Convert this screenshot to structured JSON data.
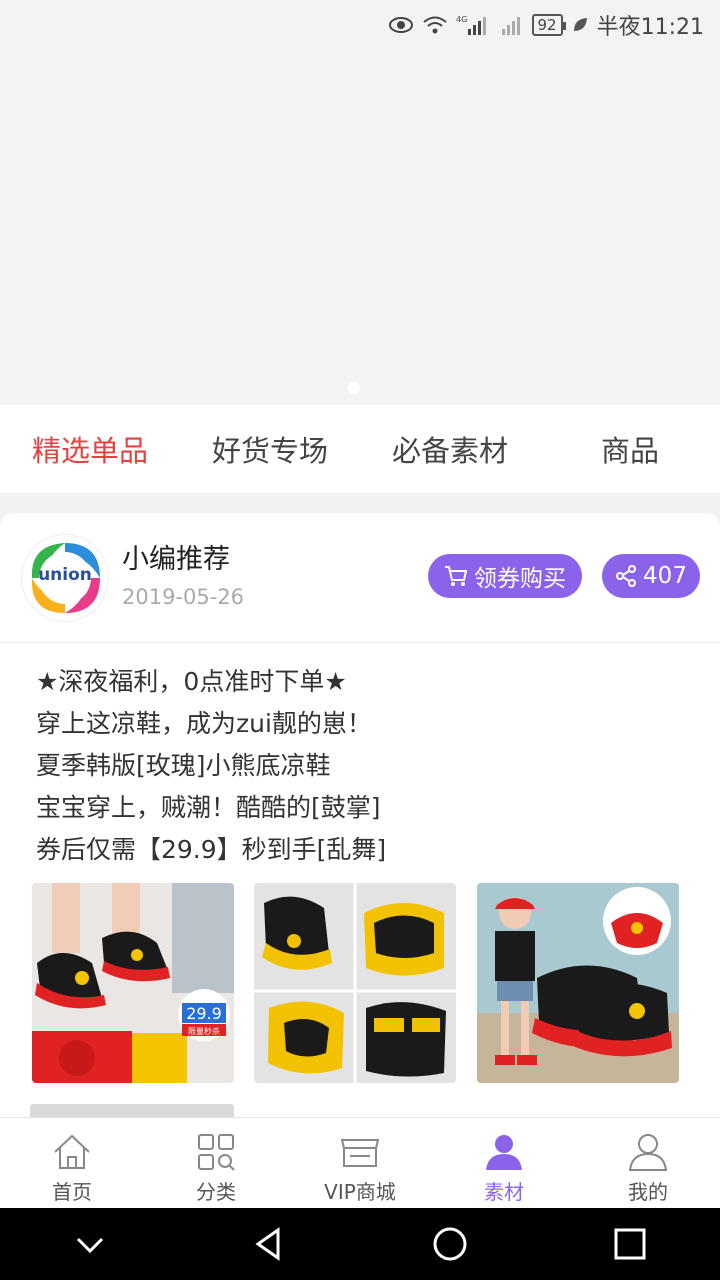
{
  "status_bar": {
    "time": "半夜11:21",
    "battery": "92",
    "network": "4G"
  },
  "tabs": [
    {
      "label": "精选单品",
      "active": true
    },
    {
      "label": "好货专场",
      "active": false
    },
    {
      "label": "必备素材",
      "active": false
    },
    {
      "label": "商品",
      "active": false
    }
  ],
  "post": {
    "logo_text": "union",
    "author": "小编推荐",
    "date": "2019-05-26",
    "coupon_button": "领券购买",
    "share_count": "407",
    "lines": [
      "★深夜福利，0点准时下单★",
      "穿上这凉鞋，成为zui靓的崽！",
      "夏季韩版[玫瑰]小熊底凉鞋",
      "宝宝穿上，贼潮！酷酷的[鼓掌]",
      "券后仅需【29.9】秒到手[乱舞]"
    ],
    "price_tag": "29.9",
    "price_tag_sub": "限量秒杀"
  },
  "bottom_nav": [
    {
      "label": "首页",
      "icon": "home-icon",
      "active": false
    },
    {
      "label": "分类",
      "icon": "category-icon",
      "active": false
    },
    {
      "label": "VIP商城",
      "icon": "store-icon",
      "active": false
    },
    {
      "label": "素材",
      "icon": "material-icon",
      "active": true
    },
    {
      "label": "我的",
      "icon": "profile-icon",
      "active": false
    }
  ],
  "colors": {
    "accent": "#8a63ea",
    "tab_active": "#e64340"
  }
}
